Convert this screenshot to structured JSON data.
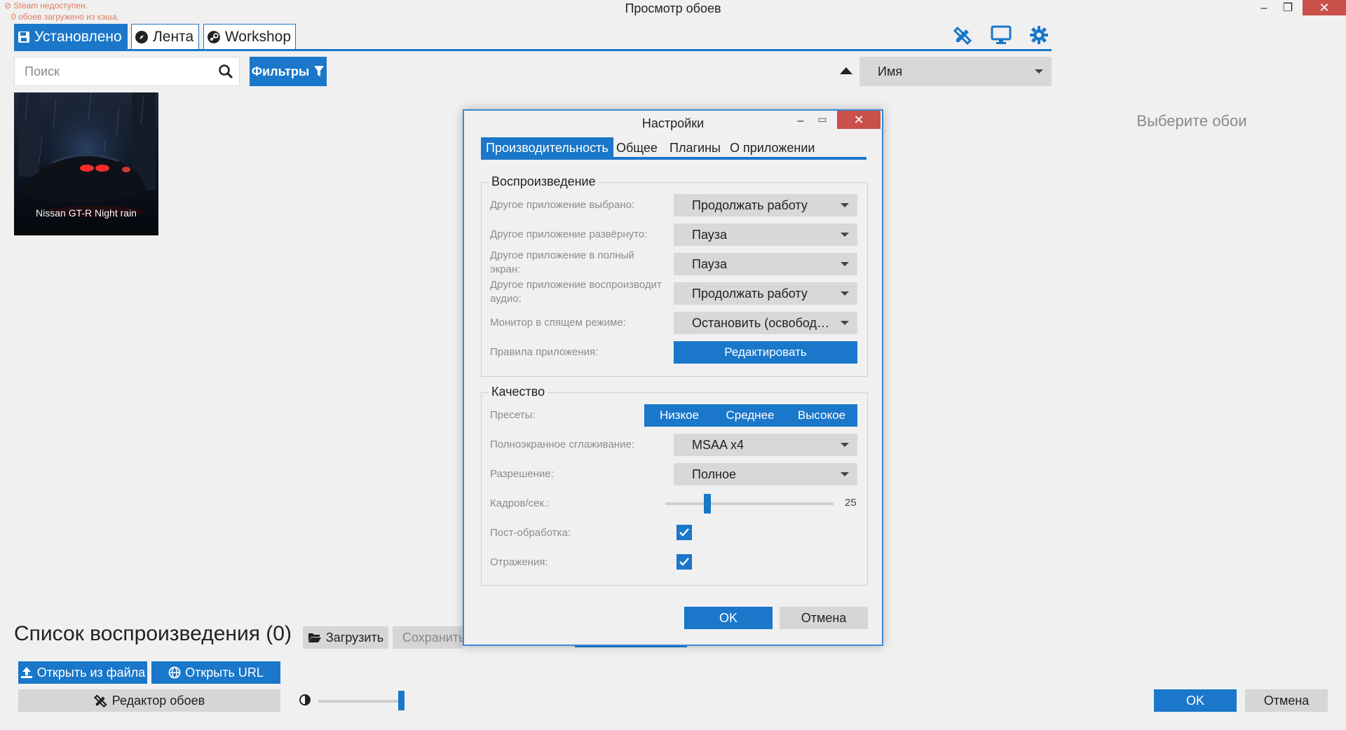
{
  "window": {
    "title": "Просмотр обоев",
    "steam_status": "Steam недоступен.",
    "cache_status": "0 обоев загружено из кэша.",
    "minimize": "–",
    "maximize": "❐",
    "close": "✕"
  },
  "tabs": [
    {
      "label": "Установлено",
      "icon": "save-icon",
      "active": true
    },
    {
      "label": "Лента",
      "icon": "compass-icon",
      "active": false
    },
    {
      "label": "Workshop",
      "icon": "steam-icon",
      "active": false
    }
  ],
  "search": {
    "placeholder": "Поиск",
    "value": ""
  },
  "filters_label": "Фильтры",
  "sort": {
    "value": "Имя"
  },
  "wallpapers": [
    {
      "title": "Nissan GT-R Night rain"
    }
  ],
  "preview_placeholder": "Выберите обои",
  "playlist": {
    "title": "Список воспроизведения (0)",
    "load_label": "Загрузить",
    "save_label": "Сохранить"
  },
  "bottom": {
    "open_file": "Открыть из файла",
    "open_url": "Открыть URL",
    "editor": "Редактор обоев",
    "brightness_level": 0.95,
    "ok": "OK",
    "cancel": "Отмена"
  },
  "colors": {
    "accent": "#1a77c9",
    "close": "#c9504b",
    "warning": "#e07a5f"
  },
  "settings": {
    "title": "Настройки",
    "tabs": [
      "Производительность",
      "Общее",
      "Плагины",
      "О приложении"
    ],
    "active_tab": 0,
    "playback": {
      "legend": "Воспроизведение",
      "rows": [
        {
          "label": "Другое приложение выбрано:",
          "value": "Продолжать работу"
        },
        {
          "label": "Другое приложение развёрнуто:",
          "value": "Пауза"
        },
        {
          "label": "Другое приложение в полный экран:",
          "value": "Пауза"
        },
        {
          "label": "Другое приложение воспроизводит аудио:",
          "value": "Продолжать работу"
        },
        {
          "label": "Монитор в спящем режиме:",
          "value": "Остановить (освободить память)"
        }
      ],
      "rules_label": "Правила приложения:",
      "edit_button": "Редактировать"
    },
    "quality": {
      "legend": "Качество",
      "presets_label": "Пресеты:",
      "presets": [
        "Низкое",
        "Среднее",
        "Высокое"
      ],
      "aa_label": "Полноэкранное сглаживание:",
      "aa_value": "MSAA x4",
      "resolution_label": "Разрешение:",
      "resolution_value": "Полное",
      "fps_label": "Кадров/сек.:",
      "fps_value": "25",
      "fps_level": 0.25,
      "post_label": "Пост-обработка:",
      "post_checked": true,
      "reflections_label": "Отражения:",
      "reflections_checked": true
    },
    "ok": "OK",
    "cancel": "Отмена"
  }
}
